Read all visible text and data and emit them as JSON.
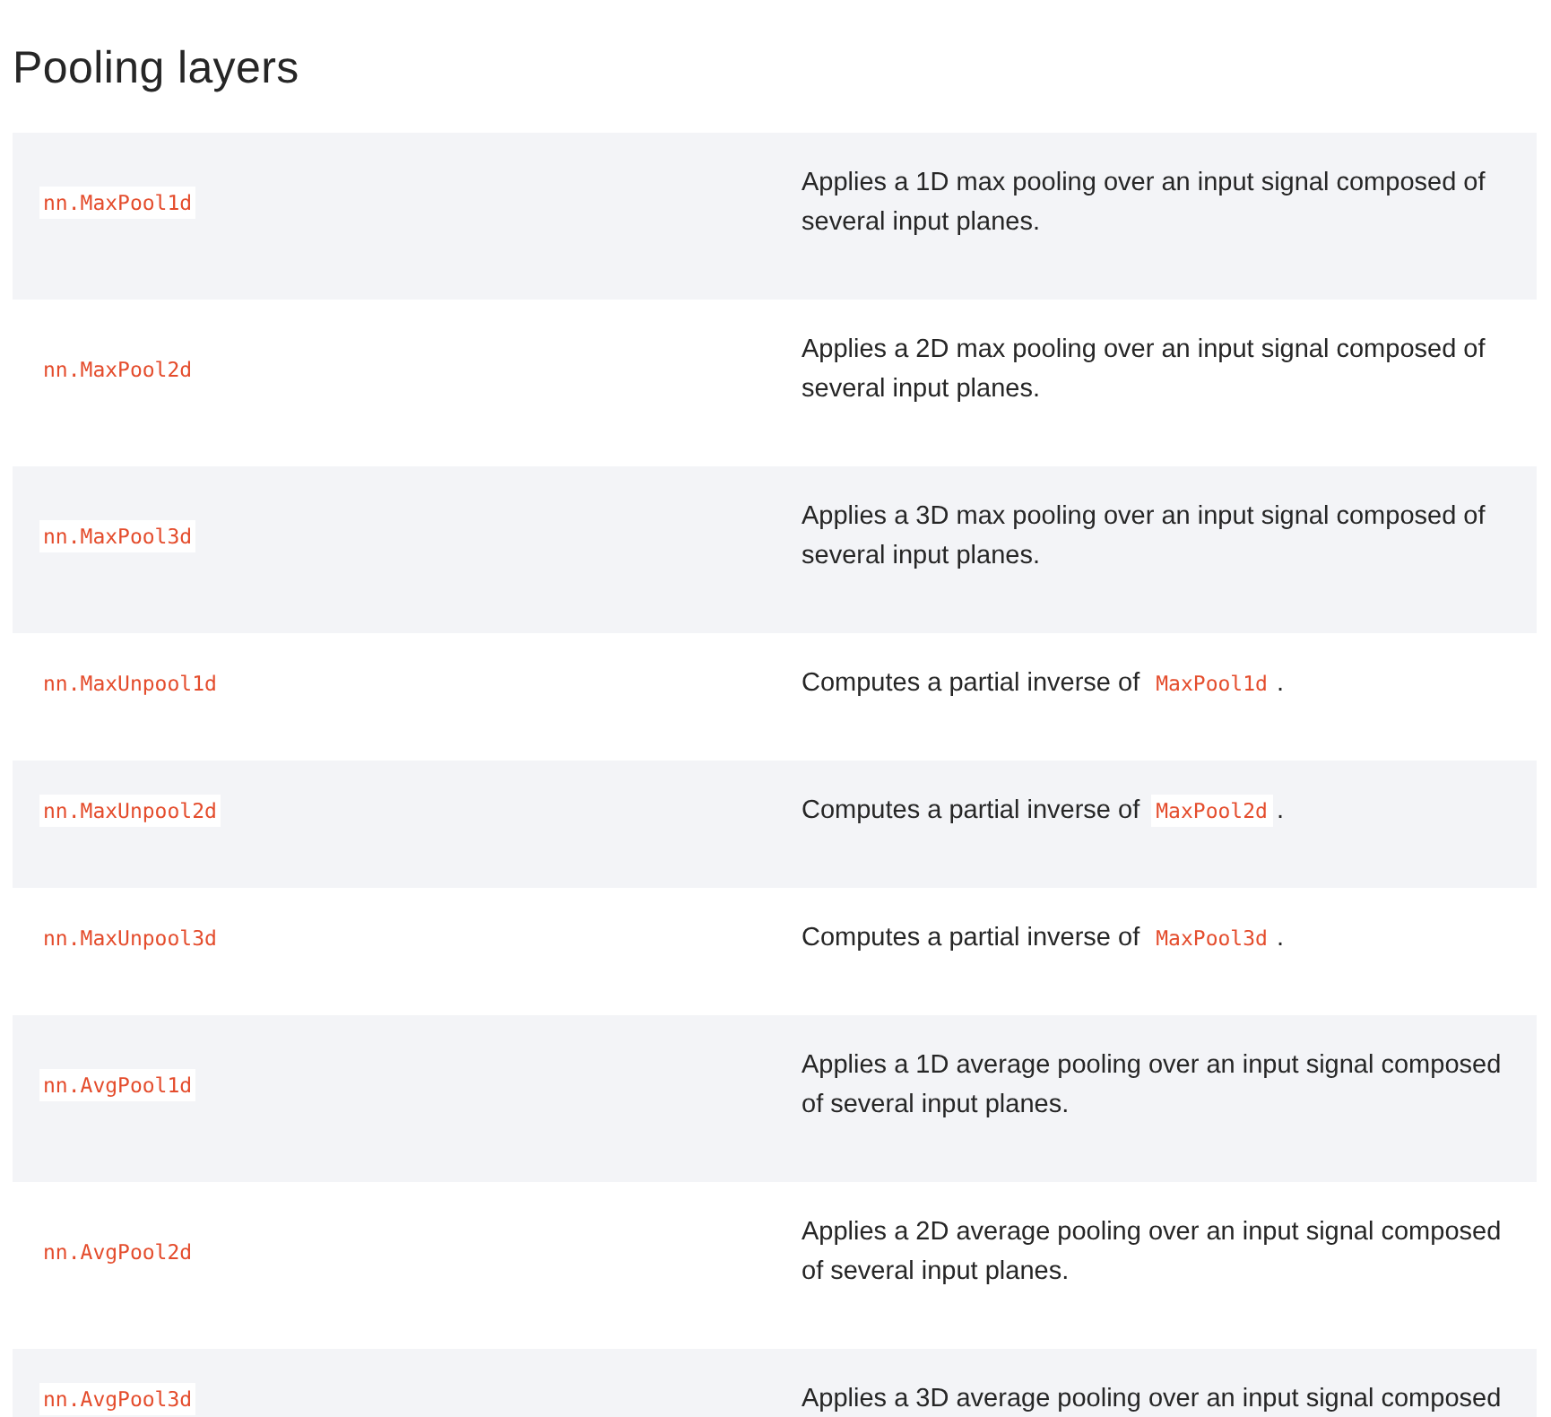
{
  "title": "Pooling layers",
  "rows": [
    {
      "name": "nn.MaxPool1d",
      "description": [
        {
          "kind": "text",
          "text": "Applies a 1D max pooling over an input signal composed of several input planes."
        }
      ]
    },
    {
      "name": "nn.MaxPool2d",
      "description": [
        {
          "kind": "text",
          "text": "Applies a 2D max pooling over an input signal composed of several input planes."
        }
      ]
    },
    {
      "name": "nn.MaxPool3d",
      "description": [
        {
          "kind": "text",
          "text": "Applies a 3D max pooling over an input signal composed of several input planes."
        }
      ]
    },
    {
      "name": "nn.MaxUnpool1d",
      "description": [
        {
          "kind": "text",
          "text": "Computes a partial inverse of "
        },
        {
          "kind": "code",
          "text": "MaxPool1d"
        },
        {
          "kind": "text",
          "text": "."
        }
      ]
    },
    {
      "name": "nn.MaxUnpool2d",
      "description": [
        {
          "kind": "text",
          "text": "Computes a partial inverse of "
        },
        {
          "kind": "code",
          "text": "MaxPool2d"
        },
        {
          "kind": "text",
          "text": "."
        }
      ]
    },
    {
      "name": "nn.MaxUnpool3d",
      "description": [
        {
          "kind": "text",
          "text": "Computes a partial inverse of "
        },
        {
          "kind": "code",
          "text": "MaxPool3d"
        },
        {
          "kind": "text",
          "text": "."
        }
      ]
    },
    {
      "name": "nn.AvgPool1d",
      "description": [
        {
          "kind": "text",
          "text": "Applies a 1D average pooling over an input signal composed of several input planes."
        }
      ]
    },
    {
      "name": "nn.AvgPool2d",
      "description": [
        {
          "kind": "text",
          "text": "Applies a 2D average pooling over an input signal composed of several input planes."
        }
      ]
    },
    {
      "name": "nn.AvgPool3d",
      "description": [
        {
          "kind": "text",
          "text": "Applies a 3D average pooling over an input signal composed"
        }
      ]
    }
  ]
}
